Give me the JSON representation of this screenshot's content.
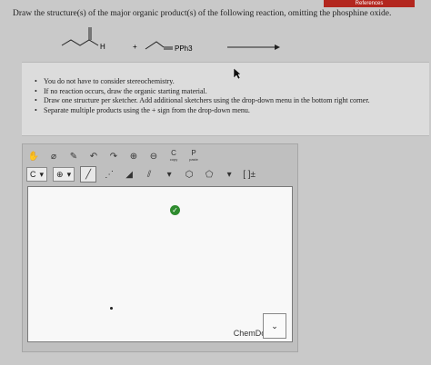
{
  "header": {
    "references_label": "References"
  },
  "question": {
    "text": "Draw the structure(s) of the major organic product(s) of the following reaction, omitting the phosphine oxide."
  },
  "reaction": {
    "aldehyde_h": "H",
    "plus": "+",
    "ylide_label": "PPh3"
  },
  "instructions": {
    "items": [
      "You do not have to consider stereochemistry.",
      "If no reaction occurs, draw the organic starting material.",
      "Draw one structure per sketcher. Add additional sketchers using the drop-down menu in the bottom right corner.",
      "Separate multiple products using the + sign from the drop-down menu."
    ]
  },
  "sketcher": {
    "toolbar1": {
      "copy_label": "copy",
      "paste_label": "paste",
      "c_letter": "C",
      "p_letter": "P"
    },
    "toolbar2": {
      "element_value": "C",
      "bracket_label": "[ ]±"
    },
    "green_button": "✓",
    "brand_label": "ChemDoodle",
    "brand_mark": "®"
  },
  "dropdown": {
    "chevron": "⌄"
  }
}
